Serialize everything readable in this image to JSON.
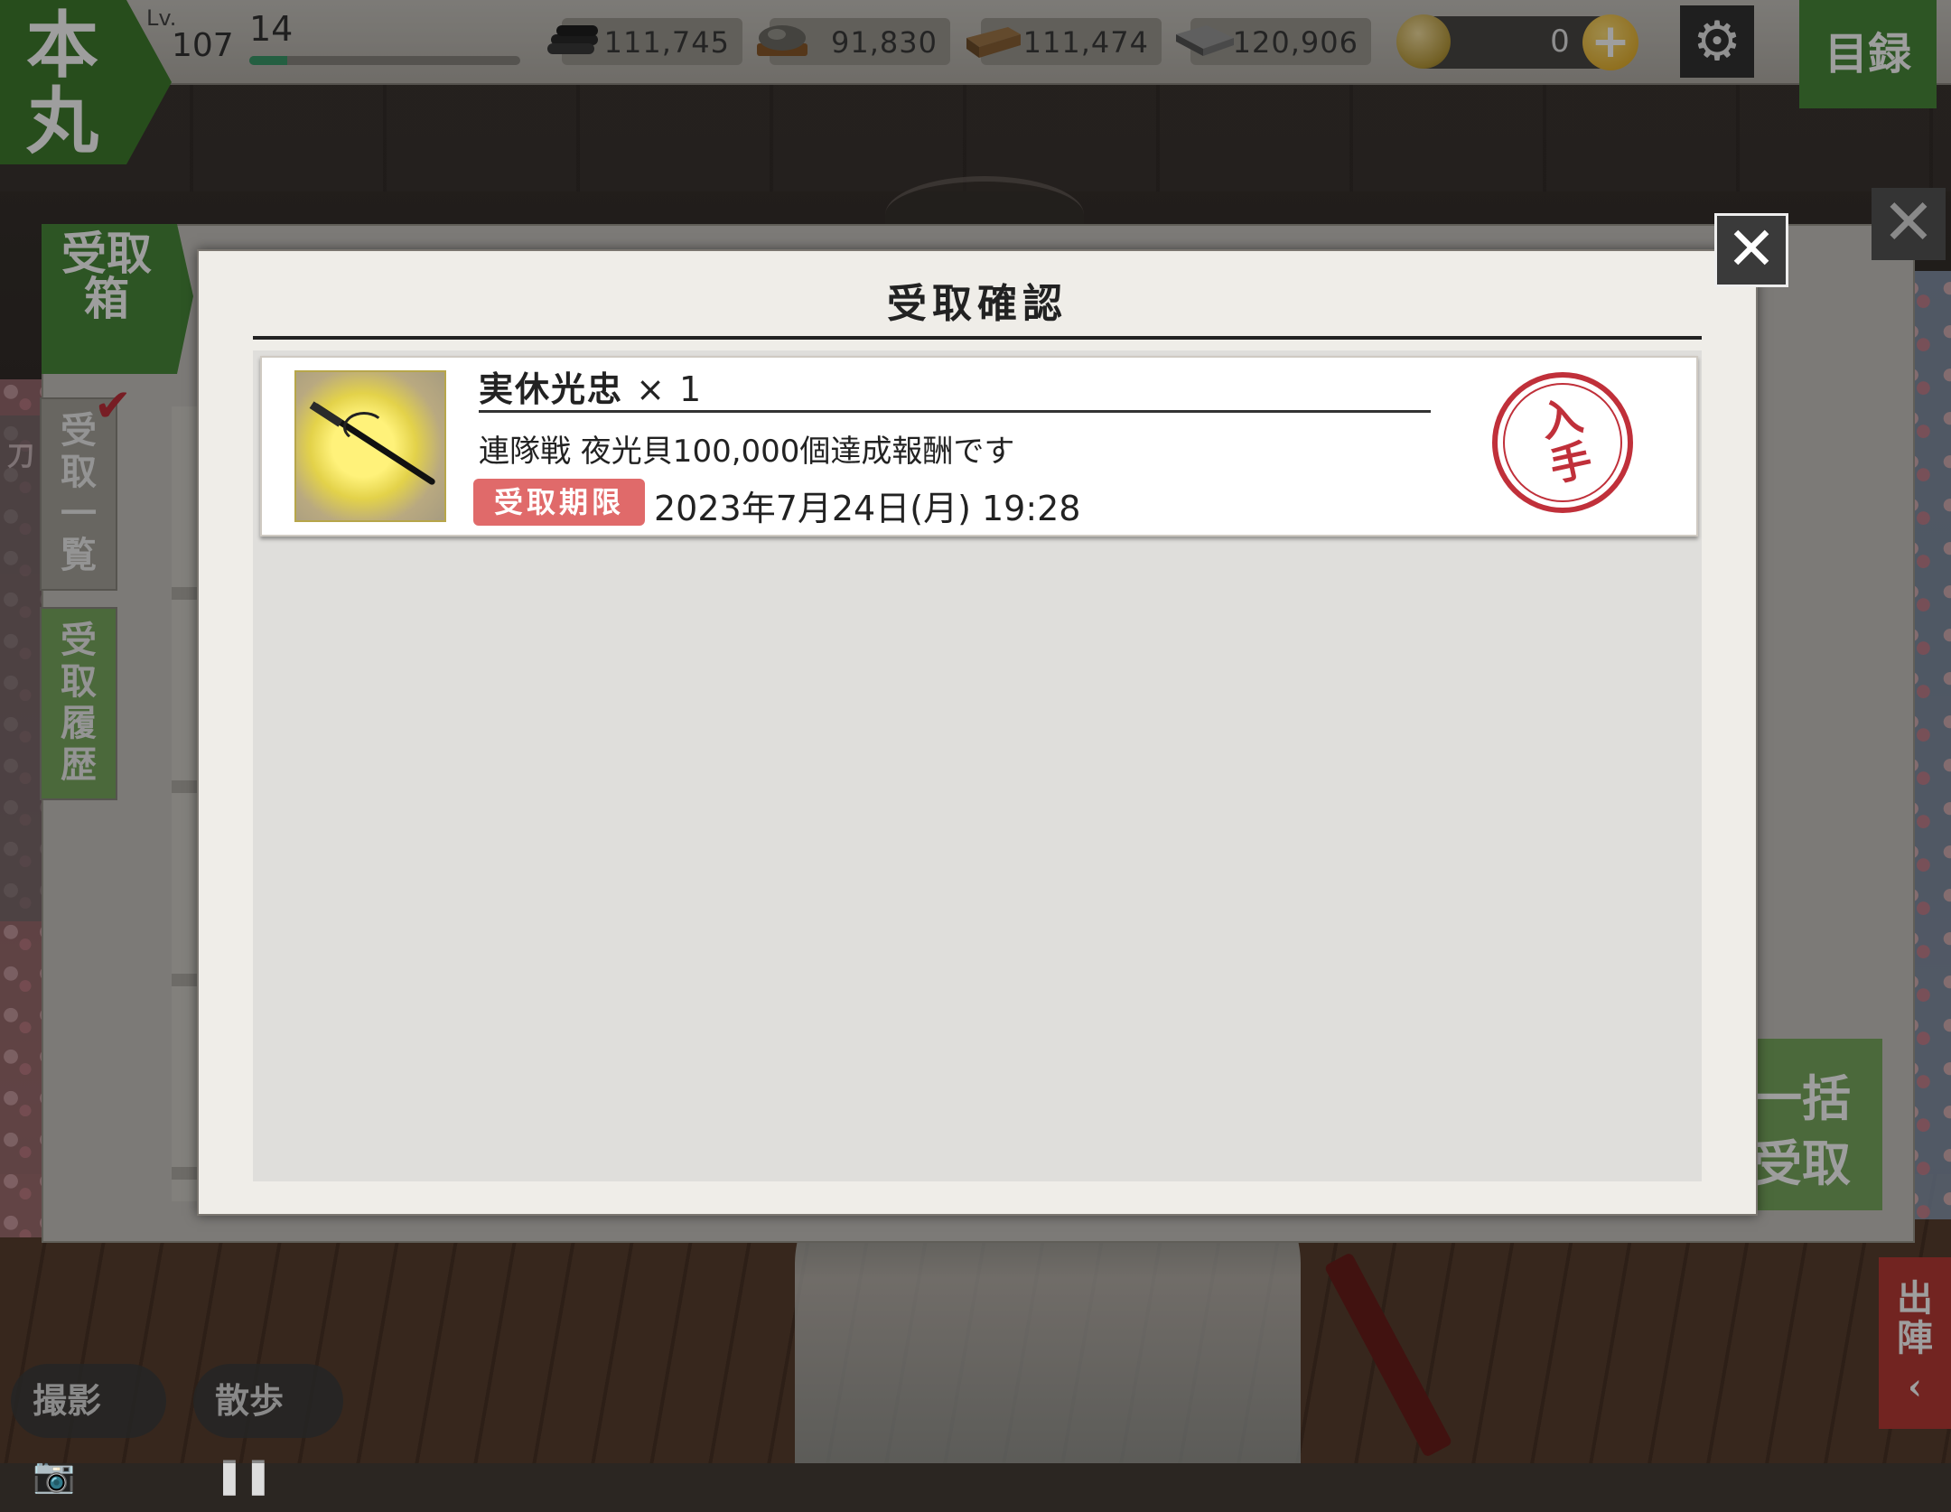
{
  "topbar": {
    "honmaru": "本丸",
    "level_label": "Lv.",
    "level": "107",
    "exp_number": "14",
    "exp_fraction": 0.14,
    "resources": [
      {
        "icon": "charcoal-icon",
        "value": "111,745"
      },
      {
        "icon": "tamahagane-icon",
        "value": "91,830"
      },
      {
        "icon": "cooling-material-icon",
        "value": "111,474"
      },
      {
        "icon": "whetstone-icon",
        "value": "120,906"
      }
    ],
    "koban": "0",
    "plus": "+",
    "mokuroku": "目録"
  },
  "inbox": {
    "title": "受取箱",
    "tab_list": "受取一覧",
    "tab_history": "受取履歴",
    "bulk_receive": "一括受取",
    "left_label": "刀"
  },
  "modal": {
    "title": "受取確認",
    "item": {
      "name": "実休光忠",
      "quantity": " × 1",
      "description": "連隊戦 夜光貝100,000個達成報酬です",
      "deadline_label": "受取期限",
      "deadline": "2023年7月24日(月) 19:28",
      "stamp": "入手"
    }
  },
  "bottom": {
    "photo": "撮影",
    "walk": "散歩",
    "sortie": "出陣"
  },
  "colors": {
    "accent_green": "#4a8a3a",
    "stamp_red": "#c0303a",
    "badge_red": "#e06a6a"
  }
}
